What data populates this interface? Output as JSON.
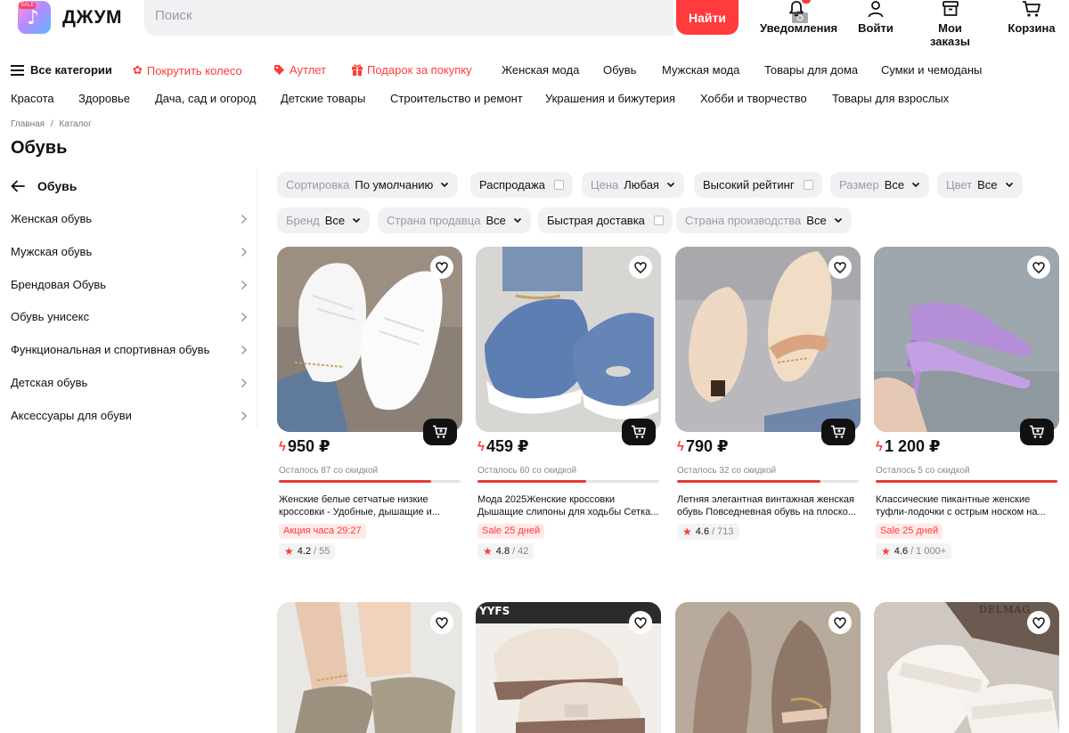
{
  "header": {
    "logo_text": "ДЖУМ",
    "logo_badge": "SALE",
    "search_placeholder": "Поиск",
    "search_button": "Найти",
    "notifications": "Уведомления",
    "login": "Войти",
    "orders": "Мои заказы",
    "cart": "Корзина"
  },
  "nav": {
    "row1": [
      {
        "label": "Все категории",
        "kind": "menu"
      },
      {
        "label": "Покрутить колесо",
        "kind": "red"
      },
      {
        "label": "Аутлет",
        "kind": "red"
      },
      {
        "label": "Подарок за покупку",
        "kind": "red"
      },
      {
        "label": "Женская мода"
      },
      {
        "label": "Обувь"
      },
      {
        "label": "Мужская мода"
      },
      {
        "label": "Товары для дома"
      },
      {
        "label": "Сумки и чемоданы"
      }
    ],
    "row2": [
      "Красота",
      "Здоровье",
      "Дача, сад и огород",
      "Детские товары",
      "Строительство и ремонт",
      "Украшения и бижутерия",
      "Хобби и творчество",
      "Товары для взрослых"
    ]
  },
  "breadcrumb": {
    "home": "Главная",
    "sep": "/",
    "catalog": "Каталог"
  },
  "page_title": "Обувь",
  "sidebar": {
    "back_label": "Обувь",
    "items": [
      "Женская обувь",
      "Мужская обувь",
      "Брендовая Обувь",
      "Обувь унисекс",
      "Функциональная и спортивная обувь",
      "Детская обувь",
      "Аксессуары для обуви"
    ]
  },
  "filters": {
    "sort": {
      "key": "Сортировка",
      "value": "По умолчанию"
    },
    "sale": "Распродажа",
    "price": {
      "key": "Цена",
      "value": "Любая"
    },
    "rating": "Высокий рейтинг",
    "size": {
      "key": "Размер",
      "value": "Все"
    },
    "color": {
      "key": "Цвет",
      "value": "Все"
    },
    "brand": {
      "key": "Бренд",
      "value": "Все"
    },
    "seller_country": {
      "key": "Страна продавца",
      "value": "Все"
    },
    "fast_delivery": "Быстрая доставка",
    "made_in": {
      "key": "Страна производства",
      "value": "Все"
    }
  },
  "products": [
    {
      "price": "950 ₽",
      "remaining": "Осталось 87 со скидкой",
      "progress": 0.84,
      "title1": "Женские белые сетчатые низкие",
      "title2": "кроссовки - Удобные, дышащие и...",
      "badge": "Акция часа 29:27",
      "rating": "4.2",
      "reviews": "/ 55",
      "image": "white-sneakers"
    },
    {
      "price": "459 ₽",
      "remaining": "Осталось 60 со скидкой",
      "progress": 0.6,
      "title1": "Мода 2025Женские кроссовки",
      "title2": "Дышащие слипоны для ходьбы Сетка...",
      "badge": "Sale 25 дней",
      "rating": "4.8",
      "reviews": "/ 42",
      "image": "blue-slipons"
    },
    {
      "price": "790 ₽",
      "remaining": "Осталось 32 со скидкой",
      "progress": 0.79,
      "title1": "Летняя элегантная винтажная женская",
      "title2": "обувь Повседневная обувь на плоско...",
      "badge": "",
      "rating": "4.6",
      "reviews": "/ 713",
      "image": "beige-flats"
    },
    {
      "price": "1 200 ₽",
      "remaining": "Осталось 5 со скидкой",
      "progress": 1.0,
      "title1": "Классические пикантные женские",
      "title2": "туфли-лодочки с острым носком на...",
      "badge": "Sale 25 дней",
      "rating": "4.6",
      "reviews": "/ 1 000+",
      "image": "lilac-pumps"
    }
  ],
  "products_row2": [
    {
      "image": "sandals-platform"
    },
    {
      "image": "beige-sneakers",
      "logo_text": "YYFS"
    },
    {
      "image": "taupe-flats"
    },
    {
      "image": "white-slides",
      "logo_text": "DELMAG"
    }
  ],
  "colors": {
    "accent": "#ff3b3b",
    "chip_bg": "#f0f1f3",
    "text": "#111111"
  }
}
